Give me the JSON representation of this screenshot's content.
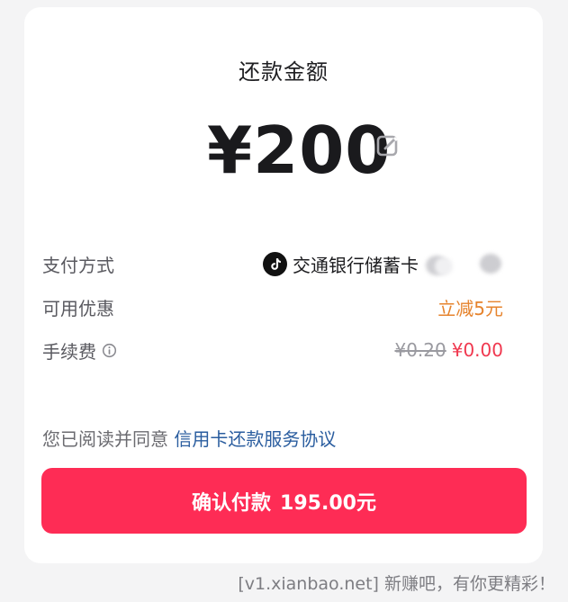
{
  "header": {
    "title": "还款金额"
  },
  "amount": {
    "value": "¥200"
  },
  "details": {
    "payment_method": {
      "label": "支付方式",
      "value": "交通银行储蓄卡"
    },
    "discount": {
      "label": "可用优惠",
      "value": "立减5元"
    },
    "fee": {
      "label": "手续费",
      "original": "¥0.20",
      "current": "¥0.00"
    }
  },
  "agreement": {
    "prefix": "您已阅读并同意",
    "link": "信用卡还款服务协议"
  },
  "confirm": {
    "label": "确认付款",
    "amount": "195.00元"
  },
  "watermark": {
    "text": "[v1.xianbao.net] 新赚吧，有你更精彩！"
  },
  "colors": {
    "accent": "#fe2c55",
    "discount": "#e6832c",
    "fee_current": "#f0384f",
    "link": "#2a5d9f"
  },
  "icons": {
    "edit": "edit-icon",
    "payment_logo": "tiktok-logo-icon",
    "info": "info-icon"
  }
}
